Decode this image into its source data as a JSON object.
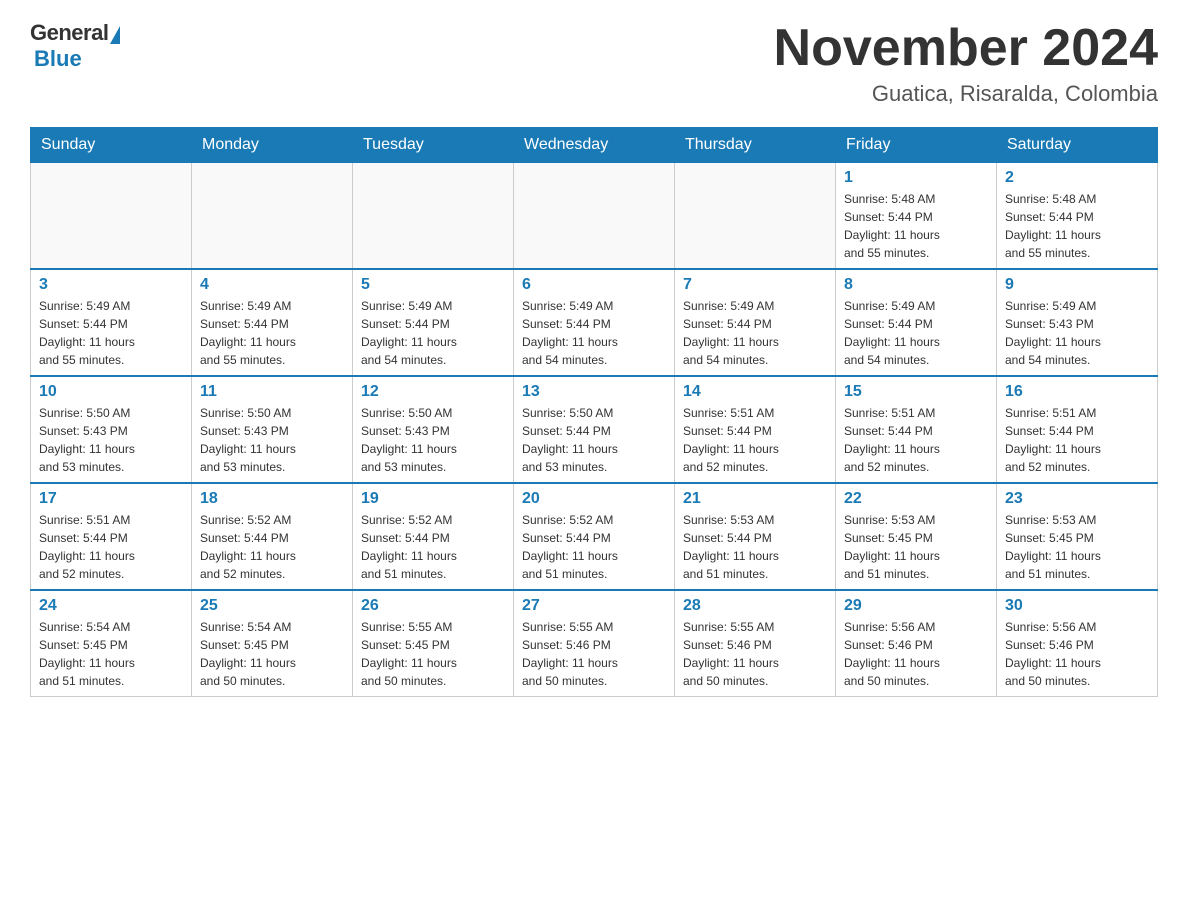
{
  "header": {
    "logo_general": "General",
    "logo_blue": "Blue",
    "title": "November 2024",
    "subtitle": "Guatica, Risaralda, Colombia"
  },
  "weekdays": [
    "Sunday",
    "Monday",
    "Tuesday",
    "Wednesday",
    "Thursday",
    "Friday",
    "Saturday"
  ],
  "weeks": [
    [
      {
        "day": "",
        "info": ""
      },
      {
        "day": "",
        "info": ""
      },
      {
        "day": "",
        "info": ""
      },
      {
        "day": "",
        "info": ""
      },
      {
        "day": "",
        "info": ""
      },
      {
        "day": "1",
        "info": "Sunrise: 5:48 AM\nSunset: 5:44 PM\nDaylight: 11 hours\nand 55 minutes."
      },
      {
        "day": "2",
        "info": "Sunrise: 5:48 AM\nSunset: 5:44 PM\nDaylight: 11 hours\nand 55 minutes."
      }
    ],
    [
      {
        "day": "3",
        "info": "Sunrise: 5:49 AM\nSunset: 5:44 PM\nDaylight: 11 hours\nand 55 minutes."
      },
      {
        "day": "4",
        "info": "Sunrise: 5:49 AM\nSunset: 5:44 PM\nDaylight: 11 hours\nand 55 minutes."
      },
      {
        "day": "5",
        "info": "Sunrise: 5:49 AM\nSunset: 5:44 PM\nDaylight: 11 hours\nand 54 minutes."
      },
      {
        "day": "6",
        "info": "Sunrise: 5:49 AM\nSunset: 5:44 PM\nDaylight: 11 hours\nand 54 minutes."
      },
      {
        "day": "7",
        "info": "Sunrise: 5:49 AM\nSunset: 5:44 PM\nDaylight: 11 hours\nand 54 minutes."
      },
      {
        "day": "8",
        "info": "Sunrise: 5:49 AM\nSunset: 5:44 PM\nDaylight: 11 hours\nand 54 minutes."
      },
      {
        "day": "9",
        "info": "Sunrise: 5:49 AM\nSunset: 5:43 PM\nDaylight: 11 hours\nand 54 minutes."
      }
    ],
    [
      {
        "day": "10",
        "info": "Sunrise: 5:50 AM\nSunset: 5:43 PM\nDaylight: 11 hours\nand 53 minutes."
      },
      {
        "day": "11",
        "info": "Sunrise: 5:50 AM\nSunset: 5:43 PM\nDaylight: 11 hours\nand 53 minutes."
      },
      {
        "day": "12",
        "info": "Sunrise: 5:50 AM\nSunset: 5:43 PM\nDaylight: 11 hours\nand 53 minutes."
      },
      {
        "day": "13",
        "info": "Sunrise: 5:50 AM\nSunset: 5:44 PM\nDaylight: 11 hours\nand 53 minutes."
      },
      {
        "day": "14",
        "info": "Sunrise: 5:51 AM\nSunset: 5:44 PM\nDaylight: 11 hours\nand 52 minutes."
      },
      {
        "day": "15",
        "info": "Sunrise: 5:51 AM\nSunset: 5:44 PM\nDaylight: 11 hours\nand 52 minutes."
      },
      {
        "day": "16",
        "info": "Sunrise: 5:51 AM\nSunset: 5:44 PM\nDaylight: 11 hours\nand 52 minutes."
      }
    ],
    [
      {
        "day": "17",
        "info": "Sunrise: 5:51 AM\nSunset: 5:44 PM\nDaylight: 11 hours\nand 52 minutes."
      },
      {
        "day": "18",
        "info": "Sunrise: 5:52 AM\nSunset: 5:44 PM\nDaylight: 11 hours\nand 52 minutes."
      },
      {
        "day": "19",
        "info": "Sunrise: 5:52 AM\nSunset: 5:44 PM\nDaylight: 11 hours\nand 51 minutes."
      },
      {
        "day": "20",
        "info": "Sunrise: 5:52 AM\nSunset: 5:44 PM\nDaylight: 11 hours\nand 51 minutes."
      },
      {
        "day": "21",
        "info": "Sunrise: 5:53 AM\nSunset: 5:44 PM\nDaylight: 11 hours\nand 51 minutes."
      },
      {
        "day": "22",
        "info": "Sunrise: 5:53 AM\nSunset: 5:45 PM\nDaylight: 11 hours\nand 51 minutes."
      },
      {
        "day": "23",
        "info": "Sunrise: 5:53 AM\nSunset: 5:45 PM\nDaylight: 11 hours\nand 51 minutes."
      }
    ],
    [
      {
        "day": "24",
        "info": "Sunrise: 5:54 AM\nSunset: 5:45 PM\nDaylight: 11 hours\nand 51 minutes."
      },
      {
        "day": "25",
        "info": "Sunrise: 5:54 AM\nSunset: 5:45 PM\nDaylight: 11 hours\nand 50 minutes."
      },
      {
        "day": "26",
        "info": "Sunrise: 5:55 AM\nSunset: 5:45 PM\nDaylight: 11 hours\nand 50 minutes."
      },
      {
        "day": "27",
        "info": "Sunrise: 5:55 AM\nSunset: 5:46 PM\nDaylight: 11 hours\nand 50 minutes."
      },
      {
        "day": "28",
        "info": "Sunrise: 5:55 AM\nSunset: 5:46 PM\nDaylight: 11 hours\nand 50 minutes."
      },
      {
        "day": "29",
        "info": "Sunrise: 5:56 AM\nSunset: 5:46 PM\nDaylight: 11 hours\nand 50 minutes."
      },
      {
        "day": "30",
        "info": "Sunrise: 5:56 AM\nSunset: 5:46 PM\nDaylight: 11 hours\nand 50 minutes."
      }
    ]
  ]
}
